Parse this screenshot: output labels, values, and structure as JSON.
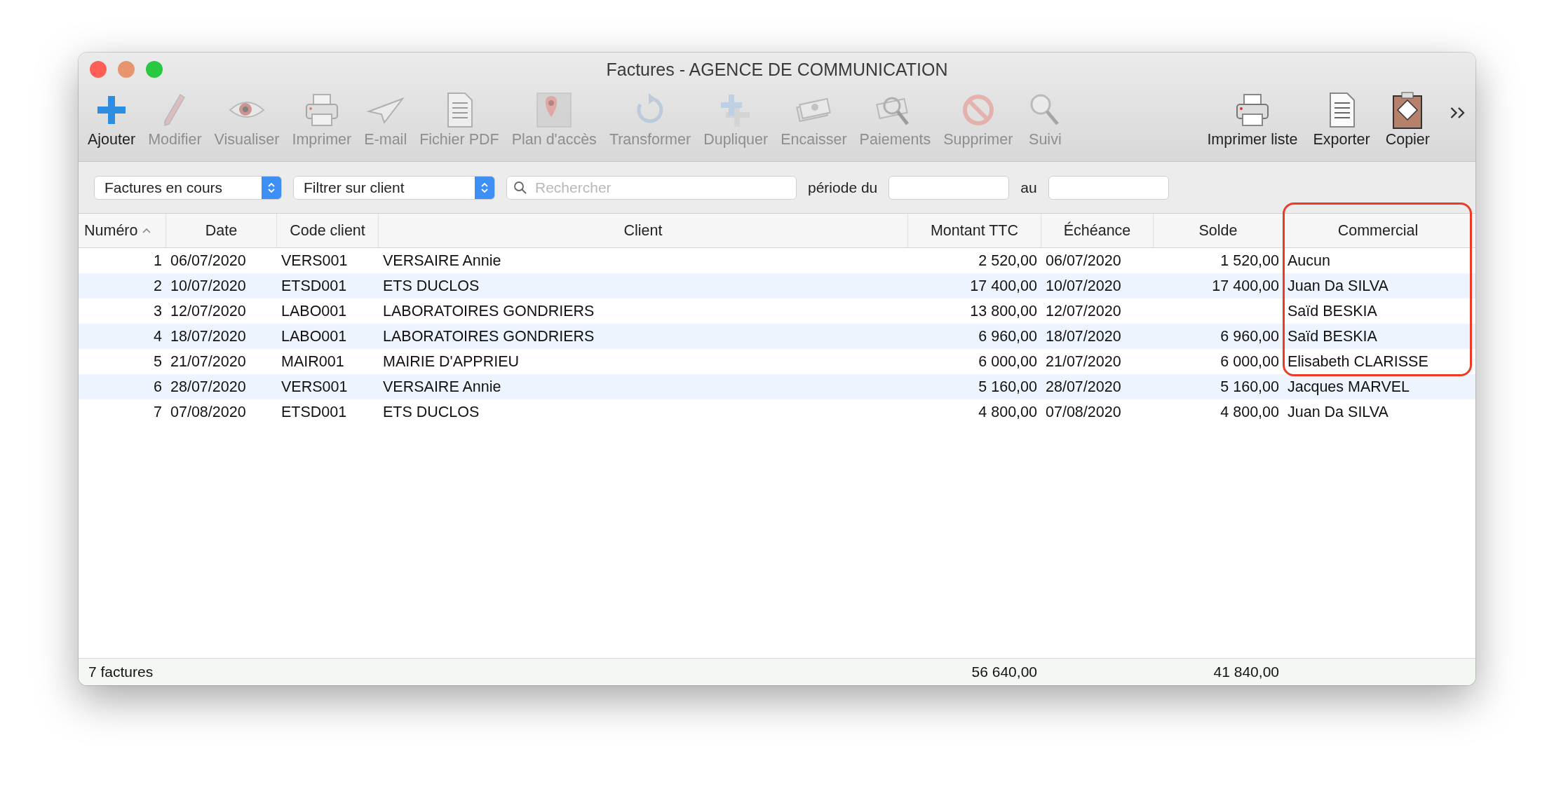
{
  "window": {
    "title": "Factures - AGENCE DE COMMUNICATION"
  },
  "toolbar": {
    "left_items": [
      {
        "kind": "add",
        "label": "Ajouter",
        "disabled": false
      },
      {
        "kind": "edit",
        "label": "Modifier",
        "disabled": true
      },
      {
        "kind": "view",
        "label": "Visualiser",
        "disabled": true
      },
      {
        "kind": "print",
        "label": "Imprimer",
        "disabled": true
      },
      {
        "kind": "mail",
        "label": "E-mail",
        "disabled": true
      },
      {
        "kind": "pdf",
        "label": "Fichier PDF",
        "disabled": true
      },
      {
        "kind": "map",
        "label": "Plan d'accès",
        "disabled": true
      },
      {
        "kind": "convert",
        "label": "Transformer",
        "disabled": true
      },
      {
        "kind": "duplicate",
        "label": "Dupliquer",
        "disabled": true
      },
      {
        "kind": "cash",
        "label": "Encaisser",
        "disabled": true
      },
      {
        "kind": "payments",
        "label": "Paiements",
        "disabled": true
      },
      {
        "kind": "delete",
        "label": "Supprimer",
        "disabled": true
      },
      {
        "kind": "track",
        "label": "Suivi",
        "disabled": true
      }
    ],
    "right_items": [
      {
        "kind": "print",
        "label": "Imprimer liste",
        "disabled": false
      },
      {
        "kind": "pdf",
        "label": "Exporter",
        "disabled": false
      },
      {
        "kind": "clipboard",
        "label": "Copier",
        "disabled": false
      }
    ]
  },
  "filters": {
    "status_select": {
      "value": "Factures en cours"
    },
    "client_select": {
      "value": "Filtrer sur client"
    },
    "search": {
      "placeholder": "Rechercher"
    },
    "period_label": "période du",
    "to_label": "au"
  },
  "table": {
    "columns": [
      {
        "label": "Numéro",
        "sorted": true
      },
      {
        "label": "Date",
        "sorted": false
      },
      {
        "label": "Code client",
        "sorted": false
      },
      {
        "label": "Client",
        "sorted": false
      },
      {
        "label": "Montant TTC",
        "sorted": false
      },
      {
        "label": "Échéance",
        "sorted": false
      },
      {
        "label": "Solde",
        "sorted": false
      },
      {
        "label": "Commercial",
        "sorted": false
      }
    ],
    "rows": [
      [
        "1",
        "06/07/2020",
        "VERS001",
        "VERSAIRE Annie",
        "2 520,00",
        "06/07/2020",
        "1 520,00",
        "Aucun"
      ],
      [
        "2",
        "10/07/2020",
        "ETSD001",
        "ETS DUCLOS",
        "17 400,00",
        "10/07/2020",
        "17 400,00",
        "Juan Da SILVA"
      ],
      [
        "3",
        "12/07/2020",
        "LABO001",
        "LABORATOIRES GONDRIERS",
        "13 800,00",
        "12/07/2020",
        null,
        "Saïd BESKIA"
      ],
      [
        "4",
        "18/07/2020",
        "LABO001",
        "LABORATOIRES GONDRIERS",
        "6 960,00",
        "18/07/2020",
        "6 960,00",
        "Saïd BESKIA"
      ],
      [
        "5",
        "21/07/2020",
        "MAIR001",
        "MAIRIE D'APPRIEU",
        "6 000,00",
        "21/07/2020",
        "6 000,00",
        "Elisabeth CLARISSE"
      ],
      [
        "6",
        "28/07/2020",
        "VERS001",
        "VERSAIRE Annie",
        "5 160,00",
        "28/07/2020",
        "5 160,00",
        "Jacques MARVEL"
      ],
      [
        "7",
        "07/08/2020",
        "ETSD001",
        "ETS DUCLOS",
        "4 800,00",
        "07/08/2020",
        "4 800,00",
        "Juan Da SILVA"
      ]
    ]
  },
  "status_bar": {
    "count": "7 factures",
    "total_ttc": "56 640,00",
    "total_solde": "41 840,00"
  }
}
